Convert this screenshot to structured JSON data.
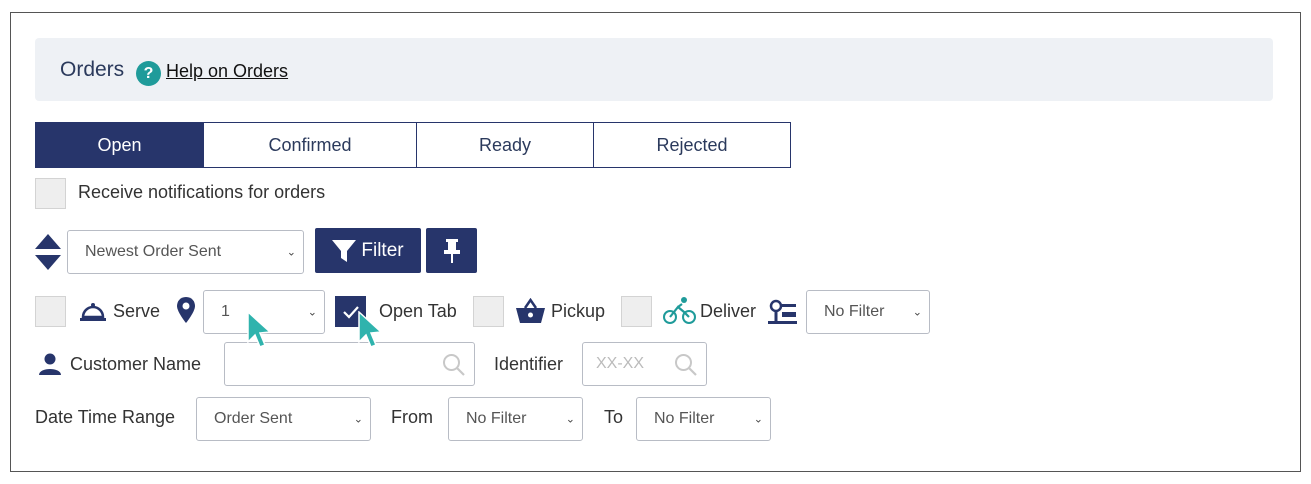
{
  "header": {
    "title": "Orders",
    "help_icon": "?",
    "help_link": "Help on Orders"
  },
  "tabs": [
    {
      "label": "Open",
      "active": true
    },
    {
      "label": "Confirmed",
      "active": false
    },
    {
      "label": "Ready",
      "active": false
    },
    {
      "label": "Rejected",
      "active": false
    }
  ],
  "notifications": {
    "label": "Receive notifications for orders",
    "checked": false
  },
  "sort": {
    "selected": "Newest Order Sent",
    "icon": "sort-updown-icon"
  },
  "filter_button": {
    "label": "Filter",
    "icon": "filter-funnel-icon"
  },
  "pin_button": {
    "icon": "pin-icon"
  },
  "order_types": {
    "serve": {
      "label": "Serve",
      "checked": false,
      "icon": "serving-cloche-icon"
    },
    "location": {
      "icon": "location-pin-icon",
      "selected": "1"
    },
    "open_tab": {
      "label": "Open Tab",
      "checked": true
    },
    "pickup": {
      "label": "Pickup",
      "checked": false,
      "icon": "basket-icon"
    },
    "deliver": {
      "label": "Deliver",
      "checked": false,
      "icon": "cyclist-icon"
    },
    "service_filter": {
      "icon": "service-options-icon",
      "selected": "No Filter"
    }
  },
  "customer": {
    "label": "Customer Name",
    "value": "",
    "placeholder": ""
  },
  "identifier": {
    "label": "Identifier",
    "placeholder": "XX-XX"
  },
  "date_range": {
    "label": "Date Time Range",
    "type_selected": "Order Sent",
    "from_label": "From",
    "from_selected": "No Filter",
    "to_label": "To",
    "to_selected": "No Filter"
  },
  "colors": {
    "primary": "#27356b",
    "accent_teal": "#1f9b9a",
    "header_bg": "#eef1f5"
  }
}
